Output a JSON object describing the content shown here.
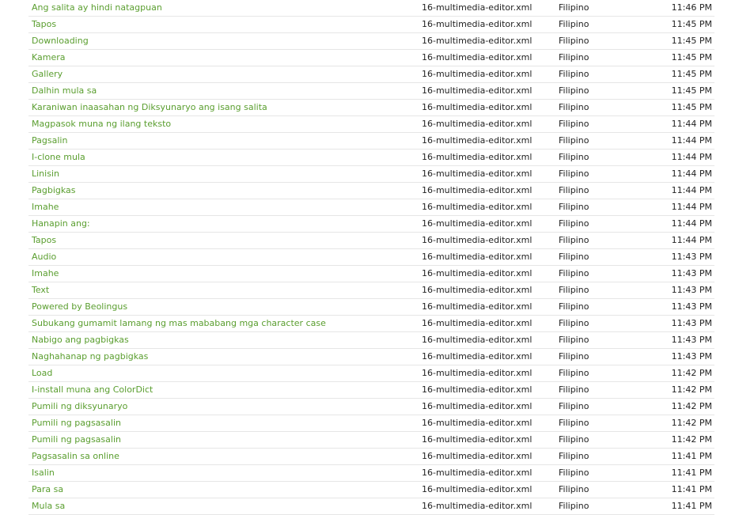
{
  "rows": [
    {
      "string": "Ang salita ay hindi natagpuan",
      "file": "16-multimedia-editor.xml",
      "language": "Filipino",
      "time": "11:46 PM"
    },
    {
      "string": "Tapos",
      "file": "16-multimedia-editor.xml",
      "language": "Filipino",
      "time": "11:45 PM"
    },
    {
      "string": "Downloading",
      "file": "16-multimedia-editor.xml",
      "language": "Filipino",
      "time": "11:45 PM"
    },
    {
      "string": "Kamera",
      "file": "16-multimedia-editor.xml",
      "language": "Filipino",
      "time": "11:45 PM"
    },
    {
      "string": "Gallery",
      "file": "16-multimedia-editor.xml",
      "language": "Filipino",
      "time": "11:45 PM"
    },
    {
      "string": "Dalhin mula sa",
      "file": "16-multimedia-editor.xml",
      "language": "Filipino",
      "time": "11:45 PM"
    },
    {
      "string": "Karaniwan inaasahan ng Diksyunaryo ang isang salita",
      "file": "16-multimedia-editor.xml",
      "language": "Filipino",
      "time": "11:45 PM"
    },
    {
      "string": "Magpasok muna ng ilang teksto",
      "file": "16-multimedia-editor.xml",
      "language": "Filipino",
      "time": "11:44 PM"
    },
    {
      "string": "Pagsalin",
      "file": "16-multimedia-editor.xml",
      "language": "Filipino",
      "time": "11:44 PM"
    },
    {
      "string": "I-clone mula",
      "file": "16-multimedia-editor.xml",
      "language": "Filipino",
      "time": "11:44 PM"
    },
    {
      "string": "Linisin",
      "file": "16-multimedia-editor.xml",
      "language": "Filipino",
      "time": "11:44 PM"
    },
    {
      "string": "Pagbigkas",
      "file": "16-multimedia-editor.xml",
      "language": "Filipino",
      "time": "11:44 PM"
    },
    {
      "string": "Imahe",
      "file": "16-multimedia-editor.xml",
      "language": "Filipino",
      "time": "11:44 PM"
    },
    {
      "string": "Hanapin ang:",
      "file": "16-multimedia-editor.xml",
      "language": "Filipino",
      "time": "11:44 PM"
    },
    {
      "string": "Tapos",
      "file": "16-multimedia-editor.xml",
      "language": "Filipino",
      "time": "11:44 PM"
    },
    {
      "string": "Audio",
      "file": "16-multimedia-editor.xml",
      "language": "Filipino",
      "time": "11:43 PM"
    },
    {
      "string": "Imahe",
      "file": "16-multimedia-editor.xml",
      "language": "Filipino",
      "time": "11:43 PM"
    },
    {
      "string": "Text",
      "file": "16-multimedia-editor.xml",
      "language": "Filipino",
      "time": "11:43 PM"
    },
    {
      "string": "Powered by Beolingus",
      "file": "16-multimedia-editor.xml",
      "language": "Filipino",
      "time": "11:43 PM"
    },
    {
      "string": "Subukang gumamit lamang ng mas mababang mga character case",
      "file": "16-multimedia-editor.xml",
      "language": "Filipino",
      "time": "11:43 PM"
    },
    {
      "string": "Nabigo ang pagbigkas",
      "file": "16-multimedia-editor.xml",
      "language": "Filipino",
      "time": "11:43 PM"
    },
    {
      "string": "Naghahanap ng pagbigkas",
      "file": "16-multimedia-editor.xml",
      "language": "Filipino",
      "time": "11:43 PM"
    },
    {
      "string": "Load",
      "file": "16-multimedia-editor.xml",
      "language": "Filipino",
      "time": "11:42 PM"
    },
    {
      "string": "I-install muna ang ColorDict",
      "file": "16-multimedia-editor.xml",
      "language": "Filipino",
      "time": "11:42 PM"
    },
    {
      "string": "Pumili ng diksyunaryo",
      "file": "16-multimedia-editor.xml",
      "language": "Filipino",
      "time": "11:42 PM"
    },
    {
      "string": "Pumili ng pagsasalin",
      "file": "16-multimedia-editor.xml",
      "language": "Filipino",
      "time": "11:42 PM"
    },
    {
      "string": "Pumili ng pagsasalin",
      "file": "16-multimedia-editor.xml",
      "language": "Filipino",
      "time": "11:42 PM"
    },
    {
      "string": "Pagsasalin sa online",
      "file": "16-multimedia-editor.xml",
      "language": "Filipino",
      "time": "11:41 PM"
    },
    {
      "string": "Isalin",
      "file": "16-multimedia-editor.xml",
      "language": "Filipino",
      "time": "11:41 PM"
    },
    {
      "string": "Para sa",
      "file": "16-multimedia-editor.xml",
      "language": "Filipino",
      "time": "11:41 PM"
    },
    {
      "string": "Mula sa",
      "file": "16-multimedia-editor.xml",
      "language": "Filipino",
      "time": "11:41 PM"
    }
  ]
}
